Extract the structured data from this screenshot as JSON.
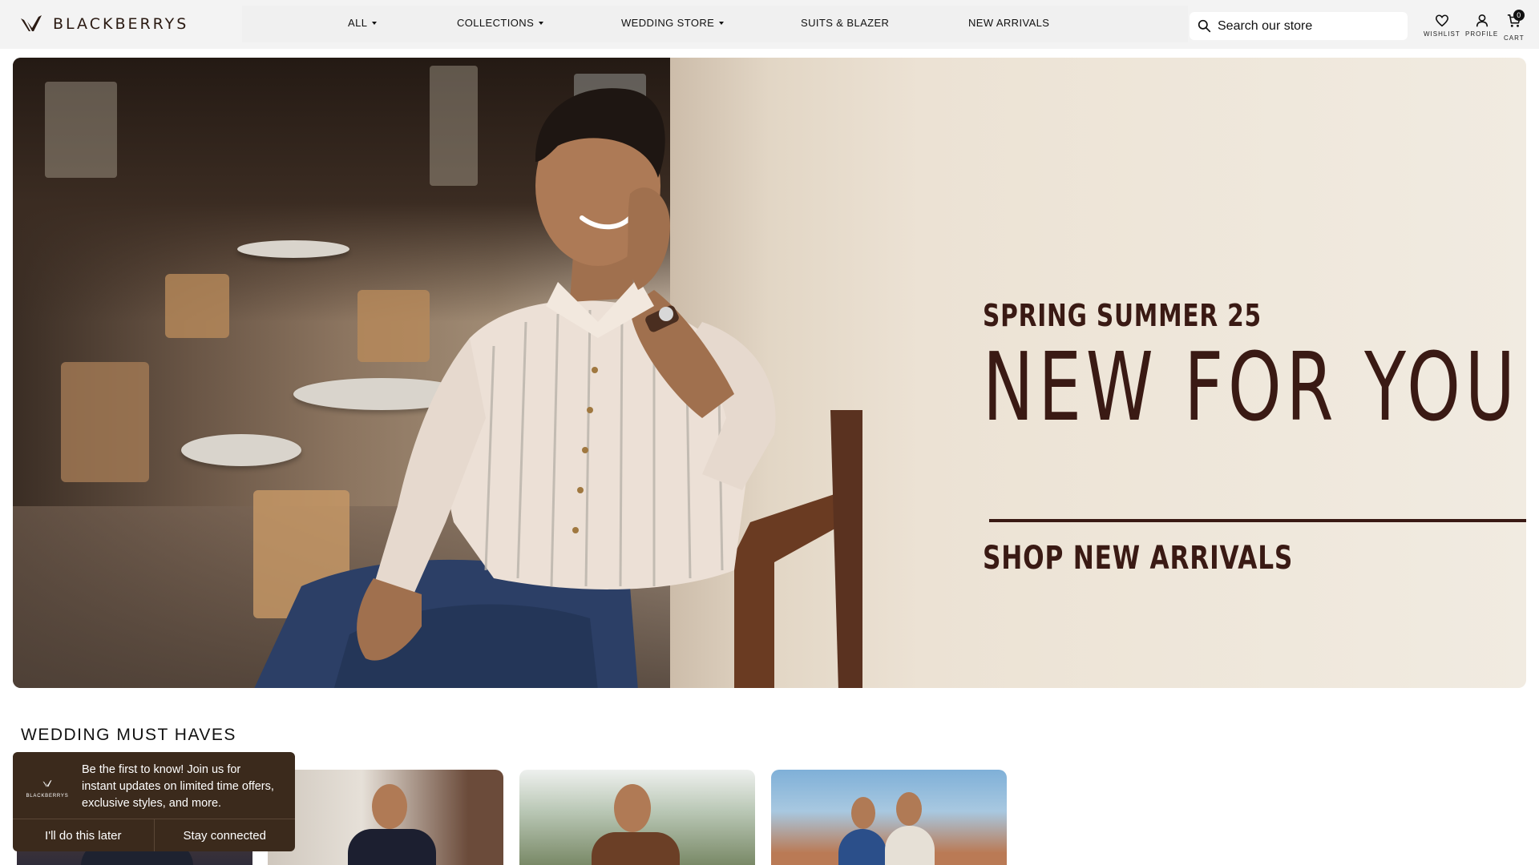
{
  "header": {
    "brand": "BLACKBERRYS",
    "nav": [
      {
        "label": "ALL",
        "has_caret": true
      },
      {
        "label": "COLLECTIONS",
        "has_caret": true
      },
      {
        "label": "WEDDING STORE",
        "has_caret": true
      },
      {
        "label": "SUITS & BLAZER",
        "has_caret": false
      },
      {
        "label": "NEW ARRIVALS",
        "has_caret": false
      }
    ],
    "search": {
      "placeholder": "Search our store",
      "icon": "search-icon"
    },
    "actions": [
      {
        "label": "WISHLIST",
        "icon": "heart-icon"
      },
      {
        "label": "PROFILE",
        "icon": "user-icon"
      },
      {
        "label": "CART",
        "icon": "cart-icon",
        "count": "0"
      }
    ]
  },
  "hero": {
    "eyebrow": "SPRING SUMMER 25",
    "headline": "NEW FOR YOU",
    "cta": "SHOP NEW ARRIVALS"
  },
  "section": {
    "title": "WEDDING MUST HAVES"
  },
  "popup": {
    "logo_text": "BLACKBERRYS",
    "message": "Be the first to know! Join us for instant updates on limited time offers, exclusive styles, and more.",
    "dismiss_label": "I'll do this later",
    "accept_label": "Stay connected"
  },
  "colors": {
    "brand_dark": "#3a1a14",
    "popup_bg": "#3b2a1c",
    "header_bg": "#f3f3f3"
  }
}
